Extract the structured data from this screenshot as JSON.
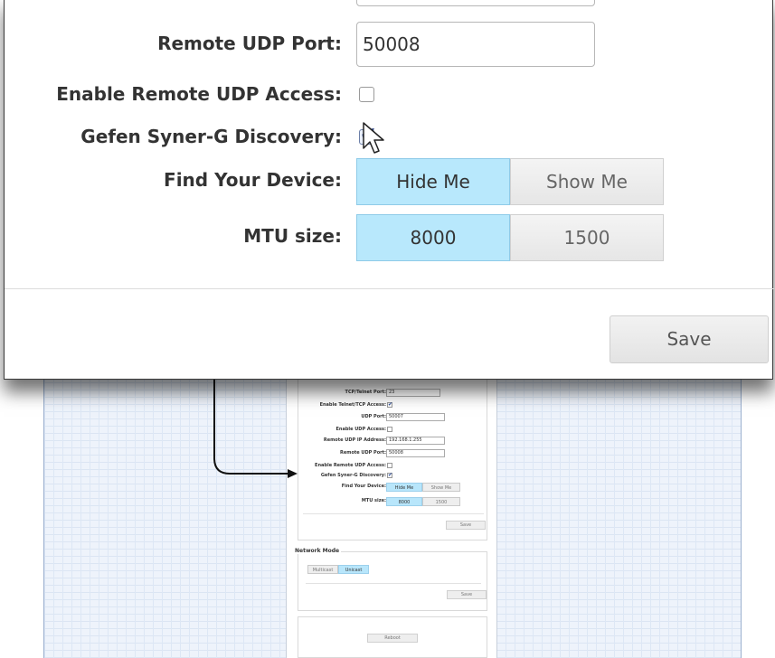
{
  "zoom": {
    "remote_udp_port_label": "Remote UDP Port:",
    "remote_udp_port_value": "50008",
    "enable_remote_udp_label": "Enable Remote UDP Access:",
    "enable_remote_udp_checked": false,
    "synerg_label": "Gefen Syner-G Discovery:",
    "synerg_checked": true,
    "find_device_label": "Find Your Device:",
    "hide_me": "Hide Me",
    "show_me": "Show Me",
    "mtu_label": "MTU size:",
    "mtu_8000": "8000",
    "mtu_1500": "1500",
    "save": "Save"
  },
  "mini": {
    "rows": [
      {
        "label": "TCP/Telnet Port:",
        "value": "23"
      },
      {
        "label": "Enable Telnet/TCP Access:",
        "checked": true
      },
      {
        "label": "UDP Port:",
        "value": "50007"
      },
      {
        "label": "Enable UDP Access:",
        "checked": false
      },
      {
        "label": "Remote UDP IP Address:",
        "value": "192.168.1.255"
      },
      {
        "label": "Remote UDP Port:",
        "value": "50008"
      },
      {
        "label": "Enable Remote UDP Access:",
        "checked": false
      },
      {
        "label": "Gefen Syner-G Discovery:",
        "checked": true
      }
    ],
    "find_device_label": "Find Your Device:",
    "hide_me": "Hide Me",
    "show_me": "Show Me",
    "mtu_label": "MTU size:",
    "mtu_8000": "8000",
    "mtu_1500": "1500",
    "save": "Save",
    "network_mode_title": "Network Mode",
    "multicast": "Multicast",
    "unicast": "Unicast",
    "save2": "Save",
    "reboot": "Reboot"
  }
}
